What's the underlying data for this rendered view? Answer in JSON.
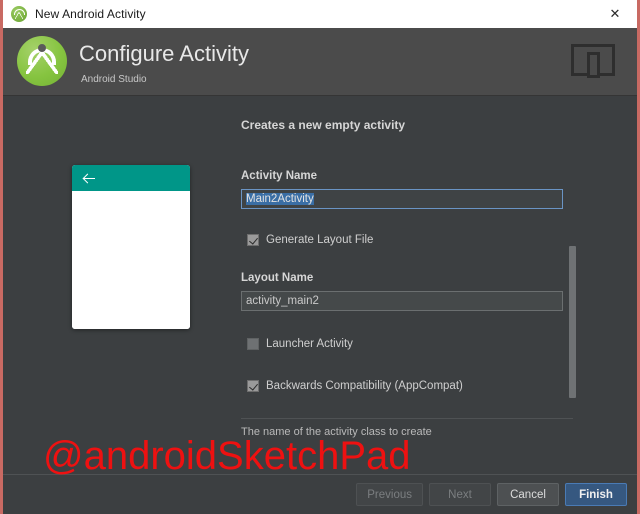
{
  "window": {
    "title": "New Android Activity",
    "close_label": "✕",
    "accent_border_color": "#c96a63"
  },
  "header": {
    "title": "Configure Activity",
    "subtitle": "Android Studio",
    "logo_icon": "android-studio-logo-icon",
    "device_icon": "device-preview-icon",
    "background_color": "#4b4b4b"
  },
  "main": {
    "description": "Creates a new empty activity",
    "preview": {
      "appbar_color": "#009688",
      "back_icon": "back-arrow-icon"
    },
    "fields": {
      "activity_name": {
        "label": "Activity Name",
        "value": "Main2Activity",
        "selected": true,
        "focused": true
      },
      "layout_name": {
        "label": "Layout Name",
        "value": "activity_main2",
        "selected": false,
        "focused": false
      }
    },
    "checkboxes": [
      {
        "label": "Generate Layout File",
        "checked": true
      },
      {
        "label": "Launcher Activity",
        "checked": false
      },
      {
        "label": "Backwards Compatibility (AppCompat)",
        "checked": true
      }
    ],
    "help_text": "The name of the activity class to create"
  },
  "footer": {
    "buttons": [
      {
        "label": "Previous",
        "state": "disabled"
      },
      {
        "label": "Next",
        "state": "disabled"
      },
      {
        "label": "Cancel",
        "state": "normal"
      },
      {
        "label": "Finish",
        "state": "default"
      }
    ]
  },
  "watermark": {
    "text": "@androidSketchPad",
    "color": "#ee1111"
  }
}
